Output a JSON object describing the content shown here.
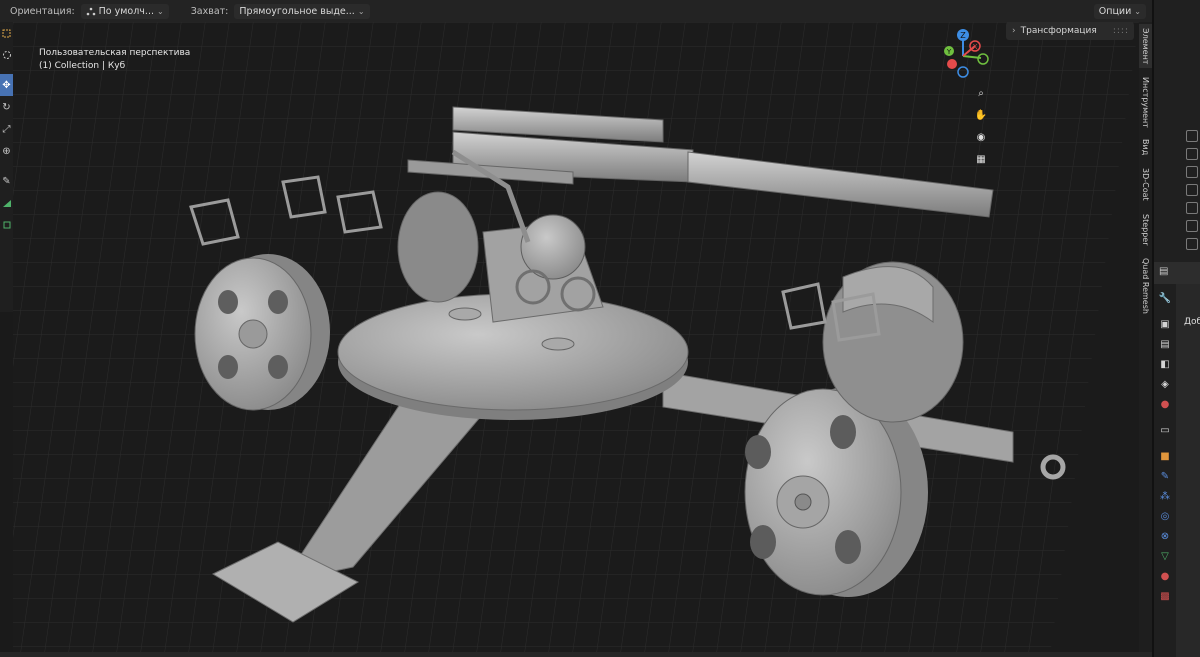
{
  "header": {
    "orientation_label": "Ориентация:",
    "orientation_value": "По умолч...",
    "snap_label": "Захват:",
    "snap_value": "Прямоугольное выде...",
    "options_label": "Опции"
  },
  "viewport": {
    "view_name": "Пользовательская перспектива",
    "collection_info": "(1) Collection | Куб"
  },
  "npanel": {
    "transform_label": "Трансформация"
  },
  "side_tabs": [
    "Элемент",
    "Инструмент",
    "Вид",
    "3D-Coat",
    "Stepper",
    "Quad Remesh"
  ],
  "gizmo": {
    "z": "Z",
    "y": "Y",
    "x": "X"
  },
  "properties": {
    "add_label": "Доб"
  },
  "icons": {
    "tools": [
      "select-box-icon",
      "cursor-icon",
      "move-icon",
      "rotate-icon",
      "scale-icon",
      "transform-icon",
      "annotate-icon",
      "measure-icon",
      "add-cube-icon"
    ],
    "nav": [
      "zoom-icon",
      "pan-hand-icon",
      "camera-icon",
      "grid-icon"
    ]
  },
  "colors": {
    "accent": "#4772b3",
    "axis_x": "#e44b4b",
    "axis_y": "#6fbf3f",
    "axis_z": "#3d8de4"
  }
}
